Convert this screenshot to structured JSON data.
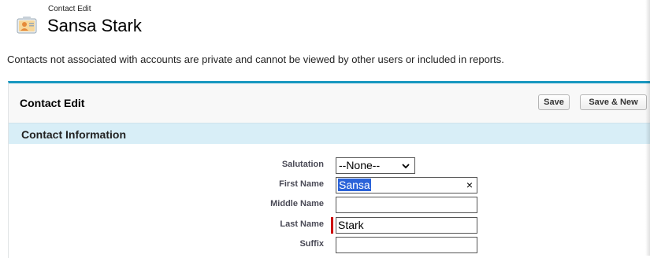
{
  "page": {
    "subtitle": "Contact Edit",
    "title": "Sansa Stark",
    "notice": "Contacts not associated with accounts are private and cannot be viewed by other users or included in reports."
  },
  "panel": {
    "title": "Contact Edit",
    "save_label": "Save",
    "save_new_label": "Save & New"
  },
  "section": {
    "title": "Contact Information"
  },
  "fields": {
    "salutation": {
      "label": "Salutation",
      "value": "--None--"
    },
    "first_name": {
      "label": "First Name",
      "value": "Sansa"
    },
    "middle_name": {
      "label": "Middle Name",
      "value": ""
    },
    "last_name": {
      "label": "Last Name",
      "value": "Stark"
    },
    "suffix": {
      "label": "Suffix",
      "value": ""
    }
  },
  "colors": {
    "accent": "#1797c0",
    "section_bg": "#d8eef7",
    "required": "#cc0000",
    "selection": "#2b63d9"
  },
  "icons": {
    "header": "contact-card-icon",
    "dropdown": "chevron-down-icon",
    "clear": "close-icon"
  }
}
